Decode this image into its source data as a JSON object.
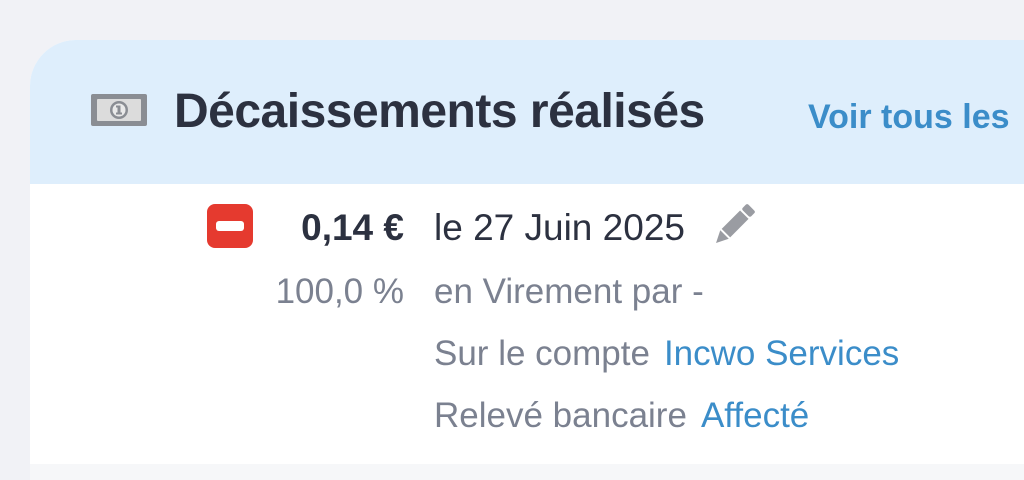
{
  "header": {
    "icon": "money-bill-icon",
    "title": "Décaissements réalisés",
    "see_all_link": "Voir tous les"
  },
  "payment": {
    "remove_icon": "minus-square-icon",
    "amount": "0,14 €",
    "percent": "100,0 %",
    "date": "le 27 Juin 2025",
    "edit_icon": "pencil-icon",
    "method": "en Virement par -",
    "account_label": "Sur le compte",
    "account_link": "Incwo Services",
    "statement_label": "Relevé bancaire",
    "statement_link": "Affecté"
  },
  "colors": {
    "header_bg": "#deeefc",
    "accent_link": "#3b8dc9",
    "danger": "#e53a2f",
    "title_text": "#2c3140",
    "muted_text": "#7b8190"
  }
}
